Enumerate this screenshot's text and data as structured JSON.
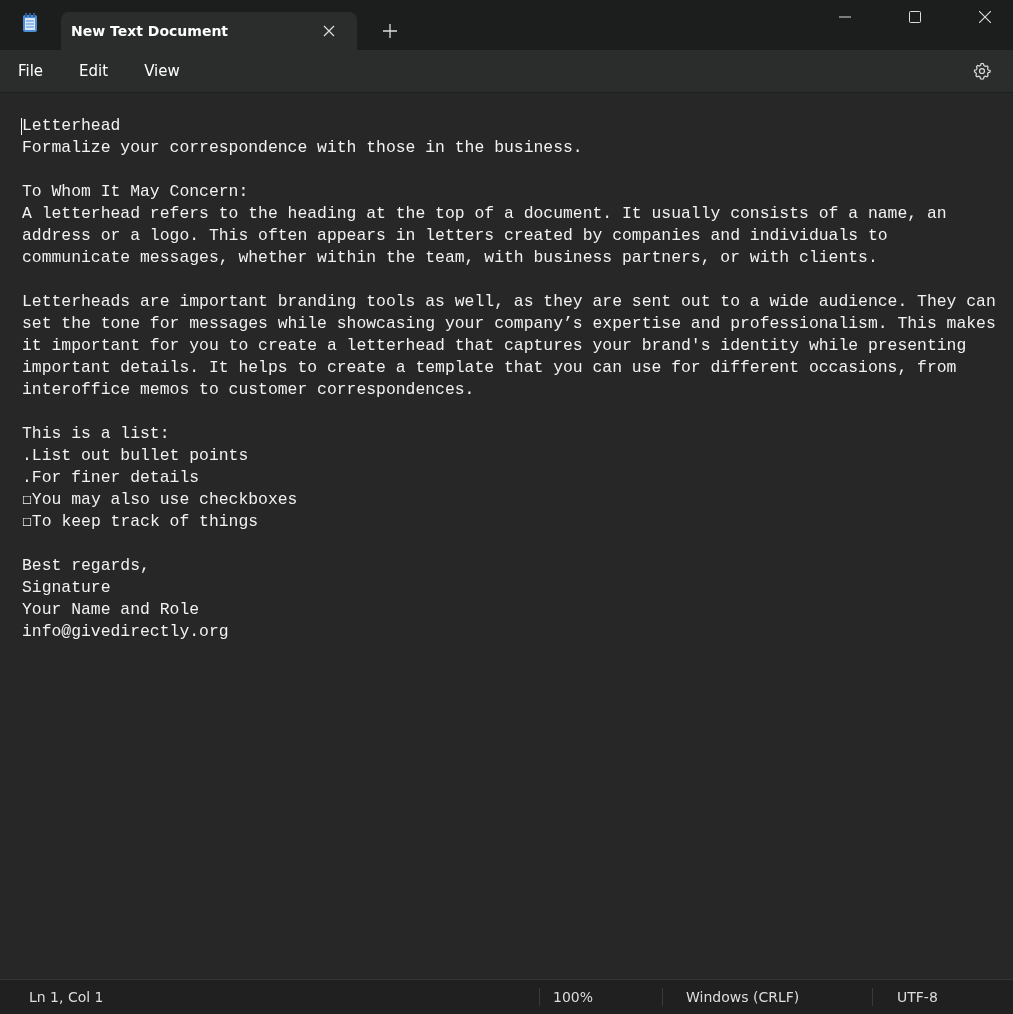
{
  "tabs": [
    {
      "title": "New Text Document",
      "selected": true
    }
  ],
  "menu": [
    "File",
    "Edit",
    "View"
  ],
  "document": {
    "paragraphs": [
      {
        "lines": [
          "Letterhead",
          "Formalize your correspondence with those in the business."
        ]
      },
      {
        "lines": [
          "To Whom It May Concern:",
          "A letterhead refers to the heading at the top of a document. It usually consists of a name, an",
          "address or a logo. This often appears in letters created by companies and individuals to",
          "communicate messages, whether within the team, with business partners, or with clients."
        ]
      },
      {
        "lines": [
          "Letterheads are important branding tools as well, as they are sent out to a wide audience. They can",
          "set the tone for messages while showcasing your company’s expertise and professionalism. This makes",
          "it important for you to create a letterhead that captures your brand's identity while presenting",
          "important details. It helps to create a template that you can use for different occasions, from",
          "interoffice memos to customer correspondences."
        ]
      },
      {
        "lines": [
          "This is a list:",
          ".List out bullet points",
          ".For finer details",
          "☐You may also use checkboxes",
          "☐To keep track of things"
        ]
      },
      {
        "lines": [
          "Best regards,",
          "Signature",
          "Your Name and Role",
          "info@givedirectly.org"
        ]
      }
    ]
  },
  "status_bar": {
    "position": "Ln 1, Col 1",
    "zoom": "100%",
    "line_endings": "Windows (CRLF)",
    "encoding": "UTF-8"
  }
}
